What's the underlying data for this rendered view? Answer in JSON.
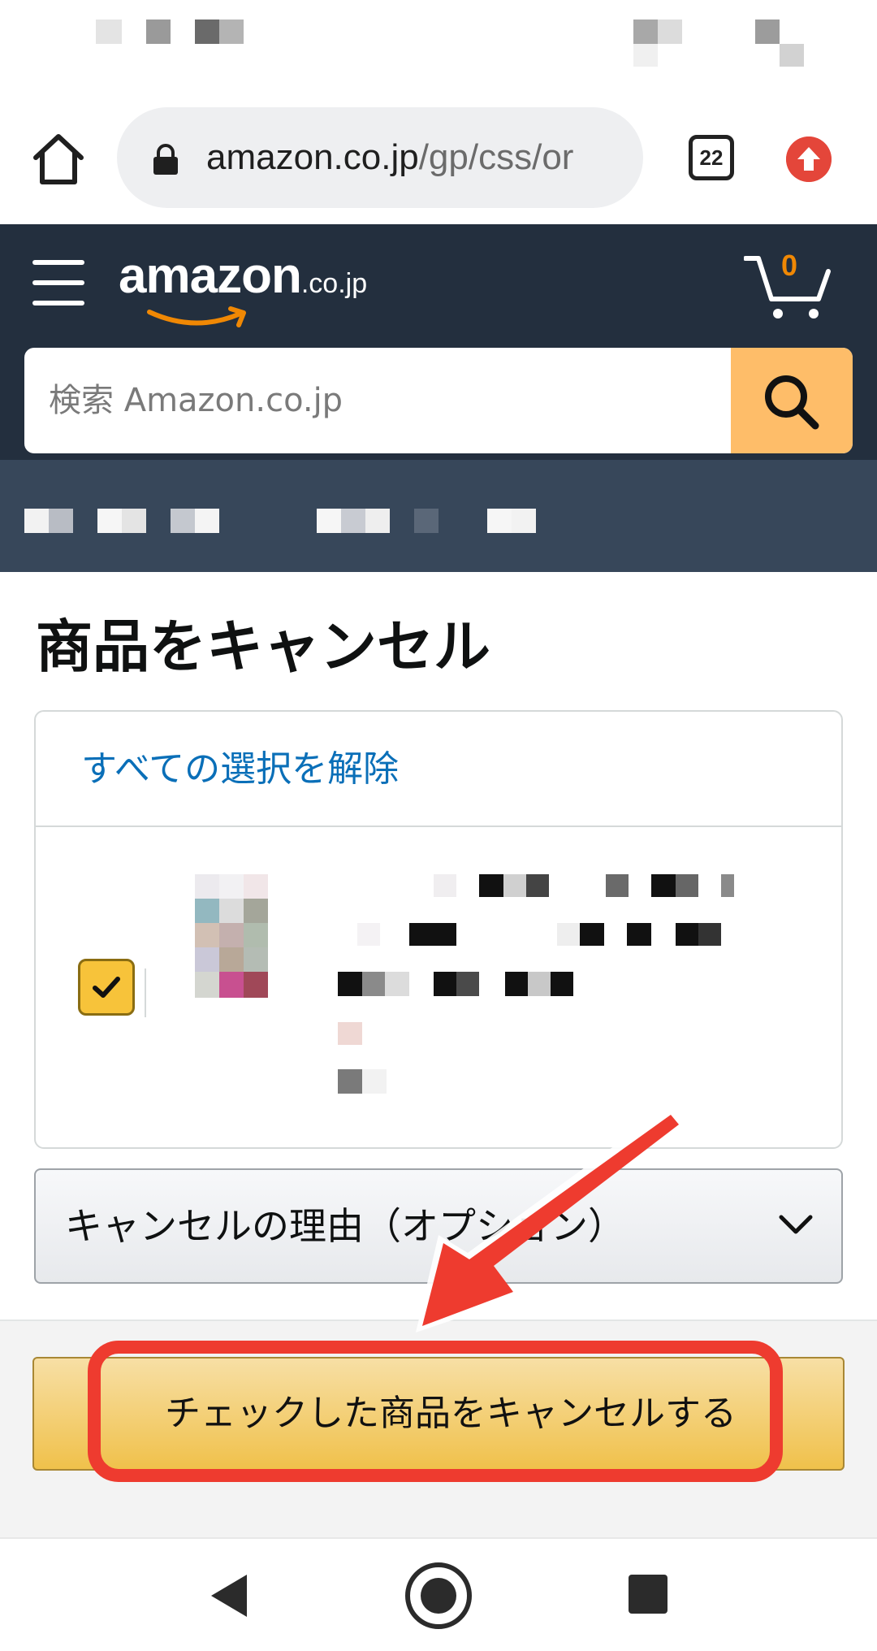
{
  "browser": {
    "url_host": "amazon.co.jp",
    "url_path": "/gp/css/or",
    "tab_count": "22"
  },
  "header": {
    "logo_text": "amazon",
    "logo_tld": ".co.jp",
    "cart_count": "0",
    "search_placeholder": "検索 Amazon.co.jp"
  },
  "main": {
    "title": "商品をキャンセル",
    "deselect_all": "すべての選択を解除",
    "item_checked": true,
    "reason_select": "キャンセルの理由（オプション）",
    "cancel_button": "チェックした商品をキャンセルする"
  },
  "colors": {
    "header_bg": "#232f3e",
    "subnav_bg": "#37475a",
    "search_button": "#febd69",
    "link": "#0a6fb8",
    "checkbox": "#f7c33a",
    "annotation": "#ee3b2f"
  },
  "icons": [
    "home-icon",
    "lock-icon",
    "tabs-icon",
    "update-icon",
    "menu-icon",
    "cart-icon",
    "search-icon",
    "check-icon",
    "chevron-down-icon",
    "back-icon",
    "home-nav-icon",
    "recents-icon"
  ]
}
